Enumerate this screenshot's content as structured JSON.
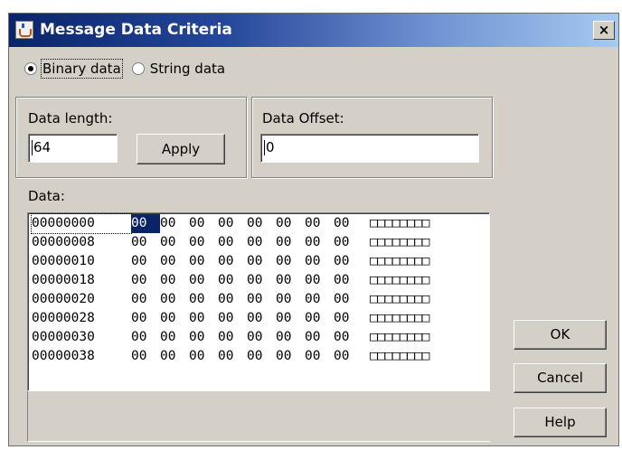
{
  "window": {
    "title": "Message Data Criteria",
    "icon": "java-cup-icon",
    "close_glyph": "×"
  },
  "data_type": {
    "options": [
      {
        "label": "Binary data",
        "selected": true
      },
      {
        "label": "String data",
        "selected": false
      }
    ]
  },
  "length": {
    "label": "Data length:",
    "value": "64",
    "apply_label": "Apply"
  },
  "offset": {
    "label": "Data Offset:",
    "value": "0"
  },
  "data_view": {
    "label": "Data:",
    "rows": [
      {
        "address": "00000000",
        "bytes": [
          "00",
          "00",
          "00",
          "00",
          "00",
          "00",
          "00",
          "00"
        ],
        "ascii": "□□□□□□□□"
      },
      {
        "address": "00000008",
        "bytes": [
          "00",
          "00",
          "00",
          "00",
          "00",
          "00",
          "00",
          "00"
        ],
        "ascii": "□□□□□□□□"
      },
      {
        "address": "00000010",
        "bytes": [
          "00",
          "00",
          "00",
          "00",
          "00",
          "00",
          "00",
          "00"
        ],
        "ascii": "□□□□□□□□"
      },
      {
        "address": "00000018",
        "bytes": [
          "00",
          "00",
          "00",
          "00",
          "00",
          "00",
          "00",
          "00"
        ],
        "ascii": "□□□□□□□□"
      },
      {
        "address": "00000020",
        "bytes": [
          "00",
          "00",
          "00",
          "00",
          "00",
          "00",
          "00",
          "00"
        ],
        "ascii": "□□□□□□□□"
      },
      {
        "address": "00000028",
        "bytes": [
          "00",
          "00",
          "00",
          "00",
          "00",
          "00",
          "00",
          "00"
        ],
        "ascii": "□□□□□□□□"
      },
      {
        "address": "00000030",
        "bytes": [
          "00",
          "00",
          "00",
          "00",
          "00",
          "00",
          "00",
          "00"
        ],
        "ascii": "□□□□□□□□"
      },
      {
        "address": "00000038",
        "bytes": [
          "00",
          "00",
          "00",
          "00",
          "00",
          "00",
          "00",
          "00"
        ],
        "ascii": "□□□□□□□□"
      }
    ]
  },
  "buttons": {
    "ok": "OK",
    "cancel": "Cancel",
    "help": "Help"
  },
  "colors": {
    "title_gradient_start": "#0a246a",
    "title_gradient_end": "#a6caf0",
    "dialog_face": "#d4d0c8",
    "selection": "#0a246a"
  }
}
